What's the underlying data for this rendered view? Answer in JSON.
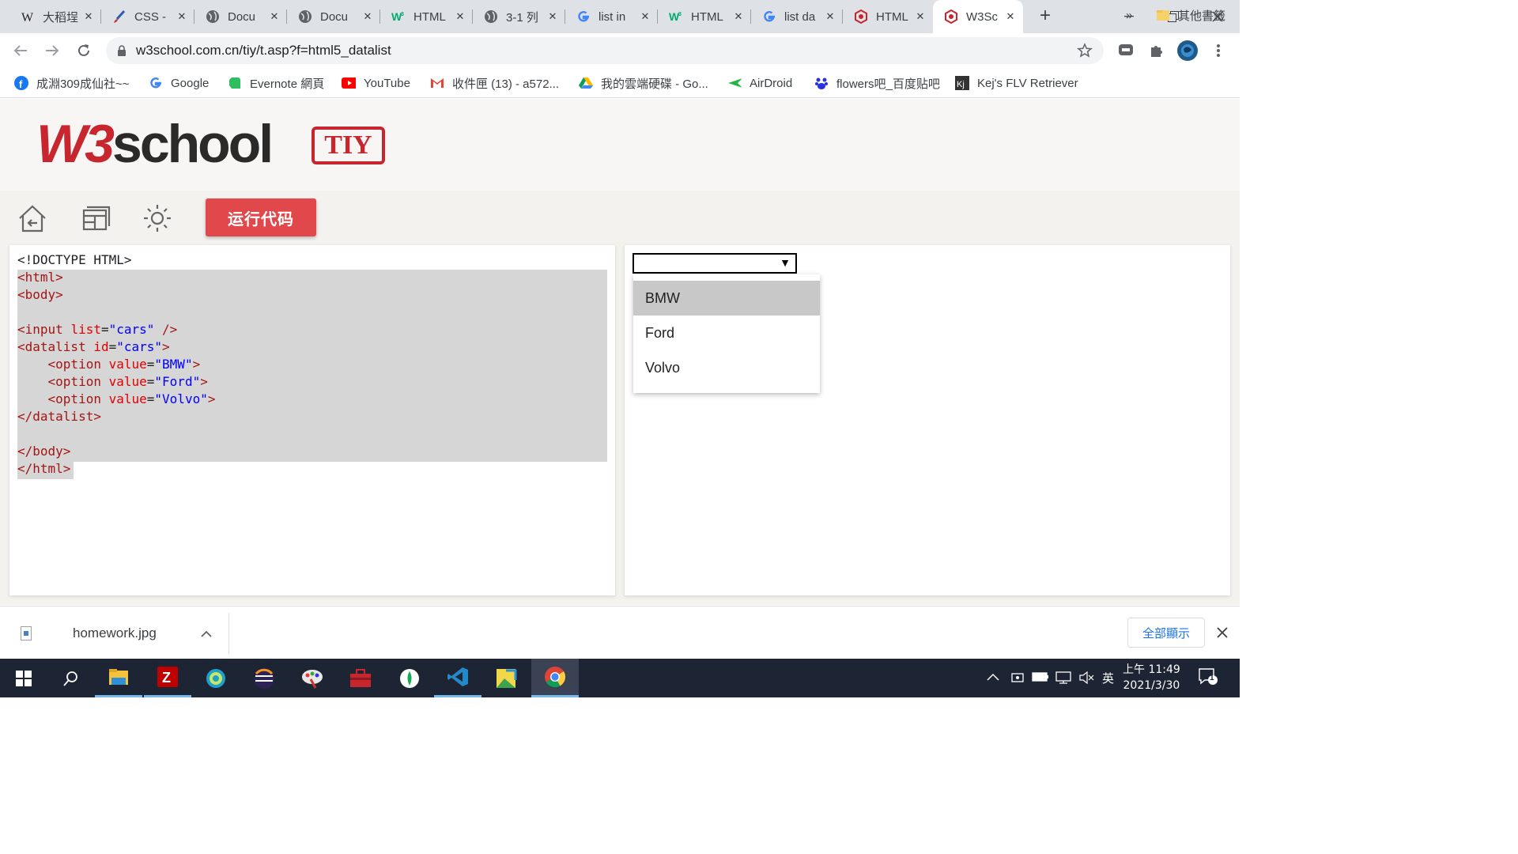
{
  "tabs": [
    {
      "title": "大稻埕",
      "icon": "wikipedia-icon"
    },
    {
      "title": "CSS -",
      "icon": "brush-icon"
    },
    {
      "title": "Docu",
      "icon": "globe-icon"
    },
    {
      "title": "Docu",
      "icon": "globe-icon"
    },
    {
      "title": "HTML",
      "icon": "w3schools-icon"
    },
    {
      "title": "3-1 列",
      "icon": "globe-icon"
    },
    {
      "title": "list in",
      "icon": "google-icon"
    },
    {
      "title": "HTML",
      "icon": "w3schools-icon"
    },
    {
      "title": "list da",
      "icon": "google-icon"
    },
    {
      "title": "HTML",
      "icon": "w3school-cn-icon"
    },
    {
      "title": "W3Sc",
      "icon": "w3school-cn-icon",
      "active": true
    }
  ],
  "address": {
    "url": "w3school.com.cn/tiy/t.asp?f=html5_datalist"
  },
  "bookmarks": [
    {
      "label": "成淵309成仙社~~",
      "icon": "facebook-icon"
    },
    {
      "label": "Google",
      "icon": "google-icon"
    },
    {
      "label": "Evernote 網頁",
      "icon": "evernote-icon"
    },
    {
      "label": "YouTube",
      "icon": "youtube-icon"
    },
    {
      "label": "收件匣 (13) - a572...",
      "icon": "gmail-icon"
    },
    {
      "label": "我的雲端硬碟 - Go...",
      "icon": "drive-icon"
    },
    {
      "label": "AirDroid",
      "icon": "airdroid-icon"
    },
    {
      "label": "flowers吧_百度贴吧",
      "icon": "baidu-icon"
    },
    {
      "label": "Kej's FLV Retriever",
      "icon": "kej-icon"
    }
  ],
  "bookmarks_more": "»",
  "other_bookmarks": "其他書籤",
  "logo": {
    "brand": "W3school",
    "badge": "TIY"
  },
  "toolbar": {
    "run_label": "运行代码"
  },
  "code_lines": [
    [
      {
        "t": "plain",
        "s": "<!DOCTYPE HTML>"
      }
    ],
    [
      {
        "t": "tag",
        "s": "<html>"
      }
    ],
    [
      {
        "t": "tag",
        "s": "<body>"
      }
    ],
    [],
    [
      {
        "t": "tag",
        "s": "<input "
      },
      {
        "t": "attr",
        "s": "list"
      },
      {
        "t": "plain",
        "s": "="
      },
      {
        "t": "val",
        "s": "\"cars\""
      },
      {
        "t": "tag",
        "s": " />"
      }
    ],
    [
      {
        "t": "tag",
        "s": "<datalist "
      },
      {
        "t": "attr",
        "s": "id"
      },
      {
        "t": "plain",
        "s": "="
      },
      {
        "t": "val",
        "s": "\"cars\""
      },
      {
        "t": "tag",
        "s": ">"
      }
    ],
    [
      {
        "t": "plain",
        "s": "    "
      },
      {
        "t": "tag",
        "s": "<option "
      },
      {
        "t": "attr",
        "s": "value"
      },
      {
        "t": "plain",
        "s": "="
      },
      {
        "t": "val",
        "s": "\"BMW\""
      },
      {
        "t": "tag",
        "s": ">"
      }
    ],
    [
      {
        "t": "plain",
        "s": "    "
      },
      {
        "t": "tag",
        "s": "<option "
      },
      {
        "t": "attr",
        "s": "value"
      },
      {
        "t": "plain",
        "s": "="
      },
      {
        "t": "val",
        "s": "\"Ford\""
      },
      {
        "t": "tag",
        "s": ">"
      }
    ],
    [
      {
        "t": "plain",
        "s": "    "
      },
      {
        "t": "tag",
        "s": "<option "
      },
      {
        "t": "attr",
        "s": "value"
      },
      {
        "t": "plain",
        "s": "="
      },
      {
        "t": "val",
        "s": "\"Volvo\""
      },
      {
        "t": "tag",
        "s": ">"
      }
    ],
    [
      {
        "t": "tag",
        "s": "</datalist>"
      }
    ],
    [],
    [
      {
        "t": "tag",
        "s": "</body>"
      }
    ],
    [
      {
        "t": "tag",
        "s": "</html>"
      }
    ]
  ],
  "result": {
    "input_value": "",
    "options": [
      "BMW",
      "Ford",
      "Volvo"
    ],
    "highlighted": "BMW"
  },
  "download": {
    "filename": "homework.jpg",
    "show_all": "全部顯示"
  },
  "taskbar": {
    "apps": [
      "start-icon",
      "search-icon",
      "file-explorer-icon",
      "filezilla-icon",
      "app-globe-icon",
      "eclipse-icon",
      "paint-icon",
      "toolbox-icon",
      "mongodb-icon",
      "vscode-icon",
      "photo-app-icon",
      "chrome-icon"
    ],
    "ime": "英",
    "time": "上午 11:49",
    "date": "2021/3/30",
    "notifications": "1"
  }
}
